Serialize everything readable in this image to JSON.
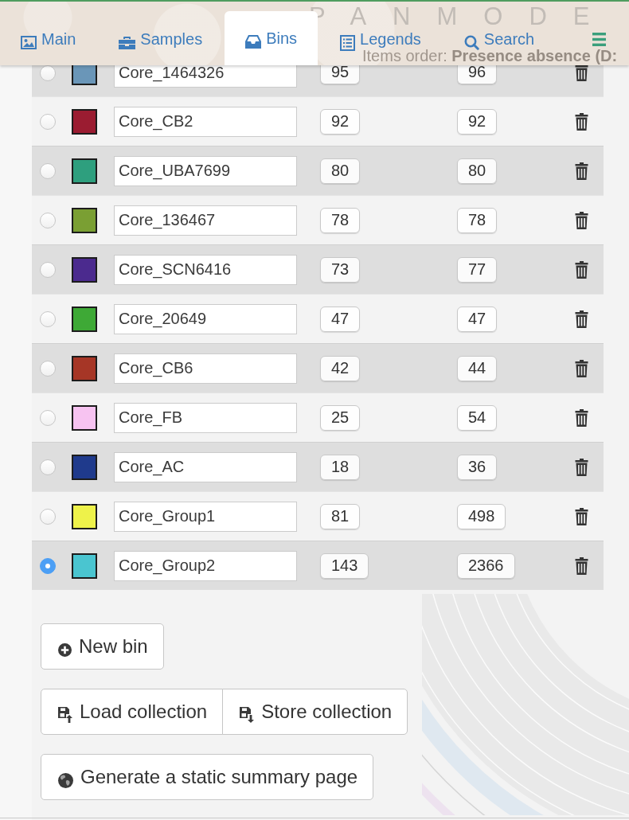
{
  "tab_bar": {
    "background_title": "PANMODE",
    "items_order": "Items order: **Presence absence (D:**"
  },
  "tabs": [
    {
      "label": "Main",
      "selected": false
    },
    {
      "label": "Samples",
      "selected": false
    },
    {
      "label": "Bins",
      "selected": true
    },
    {
      "label": "Legends",
      "selected": false
    },
    {
      "label": "Search",
      "selected": false
    }
  ],
  "bins": [
    {
      "name": "Core_1464326",
      "color": "#6a96b8",
      "column_4": "95",
      "column_5": "96",
      "selected": false
    },
    {
      "name": "Core_CB2",
      "color": "#9b1c31",
      "column_4": "92",
      "column_5": "92",
      "selected": false
    },
    {
      "name": "Core_UBA7699",
      "color": "#2e9f7e",
      "column_4": "80",
      "column_5": "80",
      "selected": false
    },
    {
      "name": "Core_136467",
      "color": "#7a9f33",
      "column_4": "78",
      "column_5": "78",
      "selected": false
    },
    {
      "name": "Core_SCN6416",
      "color": "#4b2a8e",
      "column_4": "73",
      "column_5": "77",
      "selected": false
    },
    {
      "name": "Core_20649",
      "color": "#3ea936",
      "column_4": "47",
      "column_5": "47",
      "selected": false
    },
    {
      "name": "Core_CB6",
      "color": "#a63626",
      "column_4": "42",
      "column_5": "44",
      "selected": false
    },
    {
      "name": "Core_FB",
      "color": "#f7c3f1",
      "column_4": "25",
      "column_5": "54",
      "selected": false
    },
    {
      "name": "Core_AC",
      "color": "#1f3a8c",
      "column_4": "18",
      "column_5": "36",
      "selected": false
    },
    {
      "name": "Core_Group1",
      "color": "#eef24a",
      "column_4": "81",
      "column_5": "498",
      "selected": false
    },
    {
      "name": "Core_Group2",
      "color": "#4ac5d0",
      "column_4": "143",
      "column_5": "2366",
      "selected": true
    }
  ],
  "actions": [
    [
      "New bin"
    ],
    [
      "Load collection",
      "Store collection"
    ],
    [
      "Generate a static summary page"
    ]
  ]
}
